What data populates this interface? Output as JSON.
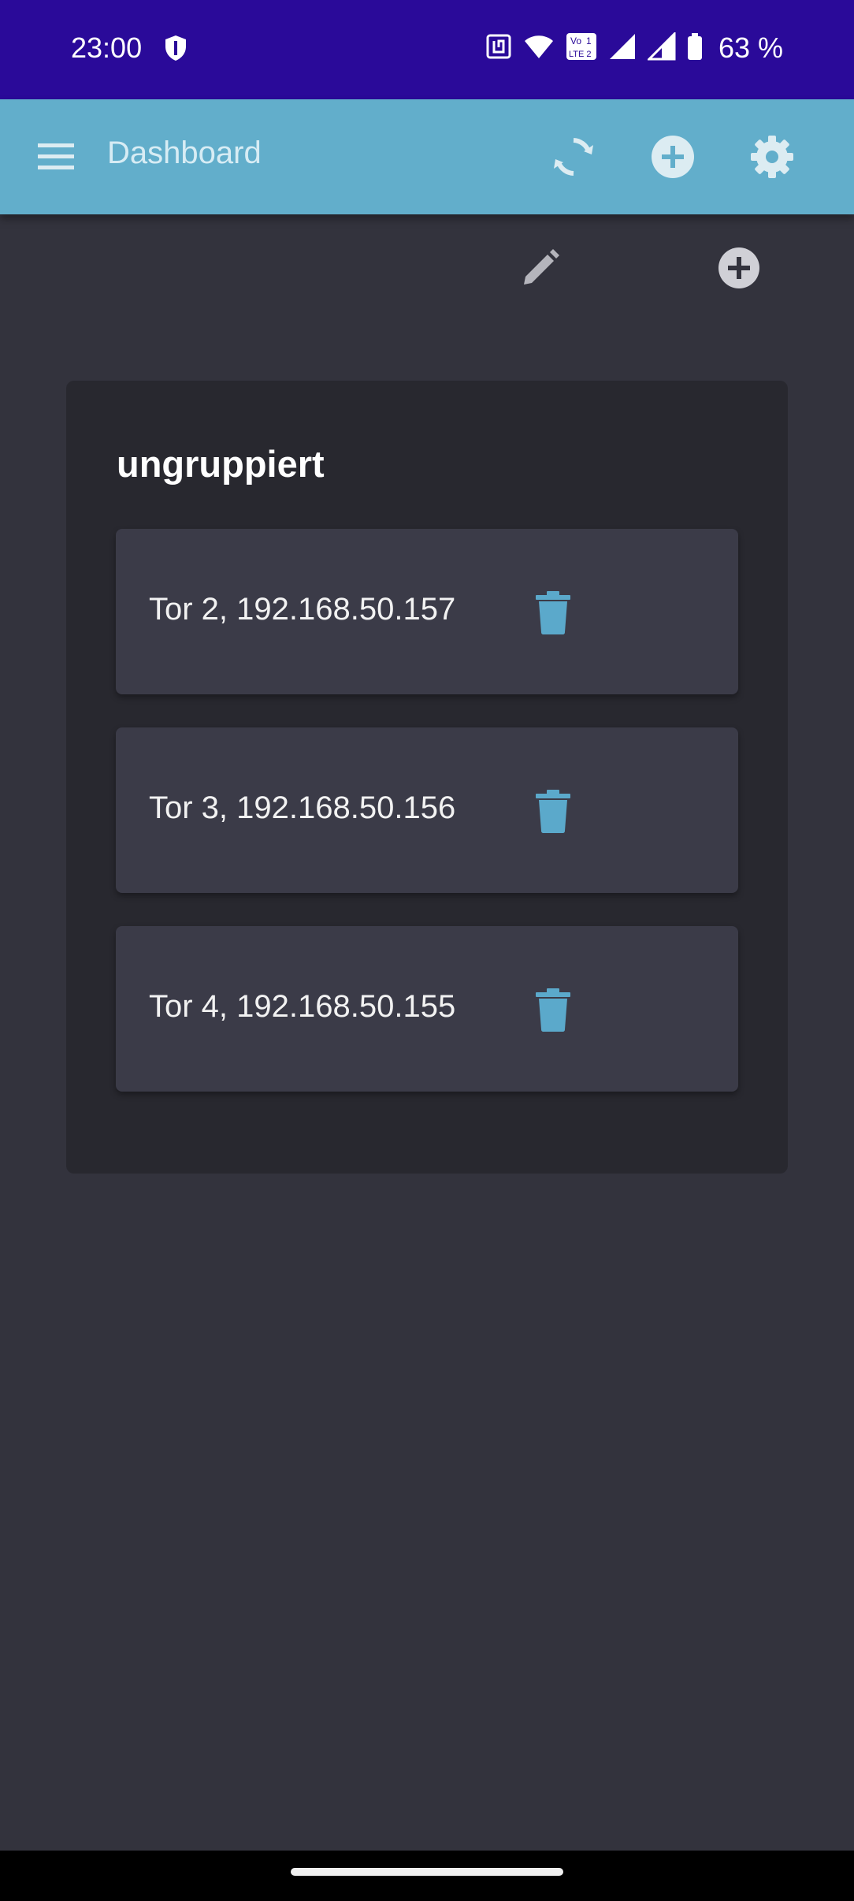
{
  "status_bar": {
    "time": "23:00",
    "battery": "63 %",
    "icons": [
      "shield-icon",
      "nfc-icon",
      "wifi-icon",
      "volte-icon",
      "signal-icon",
      "signal-icon",
      "battery-icon"
    ]
  },
  "app_bar": {
    "title": "Dashboard",
    "icons": [
      "menu-icon",
      "refresh-icon",
      "add-circle-icon",
      "settings-icon"
    ]
  },
  "toolbar": {
    "icons": [
      "pencil-icon",
      "add-circle-icon"
    ]
  },
  "group": {
    "title": "ungruppiert",
    "devices": [
      {
        "label": "Tor 2, 192.168.50.157"
      },
      {
        "label": "Tor 3, 192.168.50.156"
      },
      {
        "label": "Tor 4, 192.168.50.155"
      }
    ]
  },
  "colors": {
    "status_bar": "#2a0a99",
    "app_bar": "#62aecb",
    "background": "#33333d",
    "group_card": "#28282f",
    "device_card": "#3b3b48",
    "accent": "#5ba9cb"
  }
}
